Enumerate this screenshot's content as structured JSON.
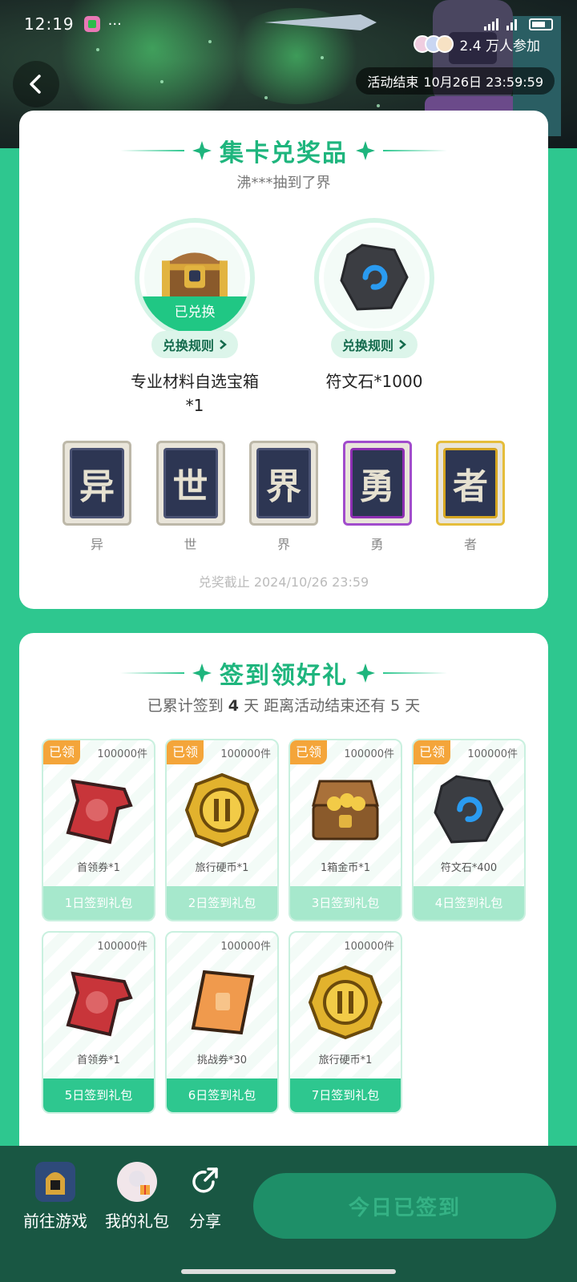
{
  "status_bar": {
    "time": "12:19",
    "dots": "···"
  },
  "header": {
    "participants": "2.4 万人参加",
    "countdown_label": "活动结束",
    "countdown_value": "10月26日 23:59:59"
  },
  "collect": {
    "title": "集卡兑奖品",
    "ticker": "沸***抽到了界",
    "prizes": [
      {
        "name": "专业材料自选宝箱*1",
        "status": "已兑换",
        "rule_label": "兑换规则",
        "icon": "treasure-chest-icon"
      },
      {
        "name": "符文石*1000",
        "status": "",
        "rule_label": "兑换规则",
        "icon": "rune-stone-icon"
      }
    ],
    "letters": [
      {
        "char": "异",
        "label": "异"
      },
      {
        "char": "世",
        "label": "世"
      },
      {
        "char": "界",
        "label": "界"
      },
      {
        "char": "勇",
        "label": "勇"
      },
      {
        "char": "者",
        "label": "者"
      }
    ],
    "deadline": "兑奖截止 2024/10/26 23:59"
  },
  "signin": {
    "title": "签到领好礼",
    "streak_prefix": "已累计签到",
    "streak_days": "4",
    "streak_suffix": "天  距离活动结束还有 5 天",
    "rewards": [
      {
        "tag": "已领",
        "count": "100000件",
        "name": "首领券*1",
        "day": "1日签到礼包",
        "icon": "boss-ticket-icon"
      },
      {
        "tag": "已领",
        "count": "100000件",
        "name": "旅行硬币*1",
        "day": "2日签到礼包",
        "icon": "travel-coin-icon"
      },
      {
        "tag": "已领",
        "count": "100000件",
        "name": "1箱金币*1",
        "day": "3日签到礼包",
        "icon": "gold-chest-icon"
      },
      {
        "tag": "已领",
        "count": "100000件",
        "name": "符文石*400",
        "day": "4日签到礼包",
        "icon": "rune-stone-icon"
      },
      {
        "tag": "",
        "count": "100000件",
        "name": "首领券*1",
        "day": "5日签到礼包",
        "icon": "boss-ticket-icon"
      },
      {
        "tag": "",
        "count": "100000件",
        "name": "挑战券*30",
        "day": "6日签到礼包",
        "icon": "challenge-ticket-icon"
      },
      {
        "tag": "",
        "count": "100000件",
        "name": "旅行硬币*1",
        "day": "7日签到礼包",
        "icon": "travel-coin-icon"
      }
    ]
  },
  "bottom_nav": {
    "game": "前往游戏",
    "gifts": "我的礼包",
    "share": "分享",
    "signed_button": "今日已签到"
  },
  "colors": {
    "accent": "#2ec78f",
    "dark": "#195743",
    "claimed_tag": "#f4a53a"
  }
}
